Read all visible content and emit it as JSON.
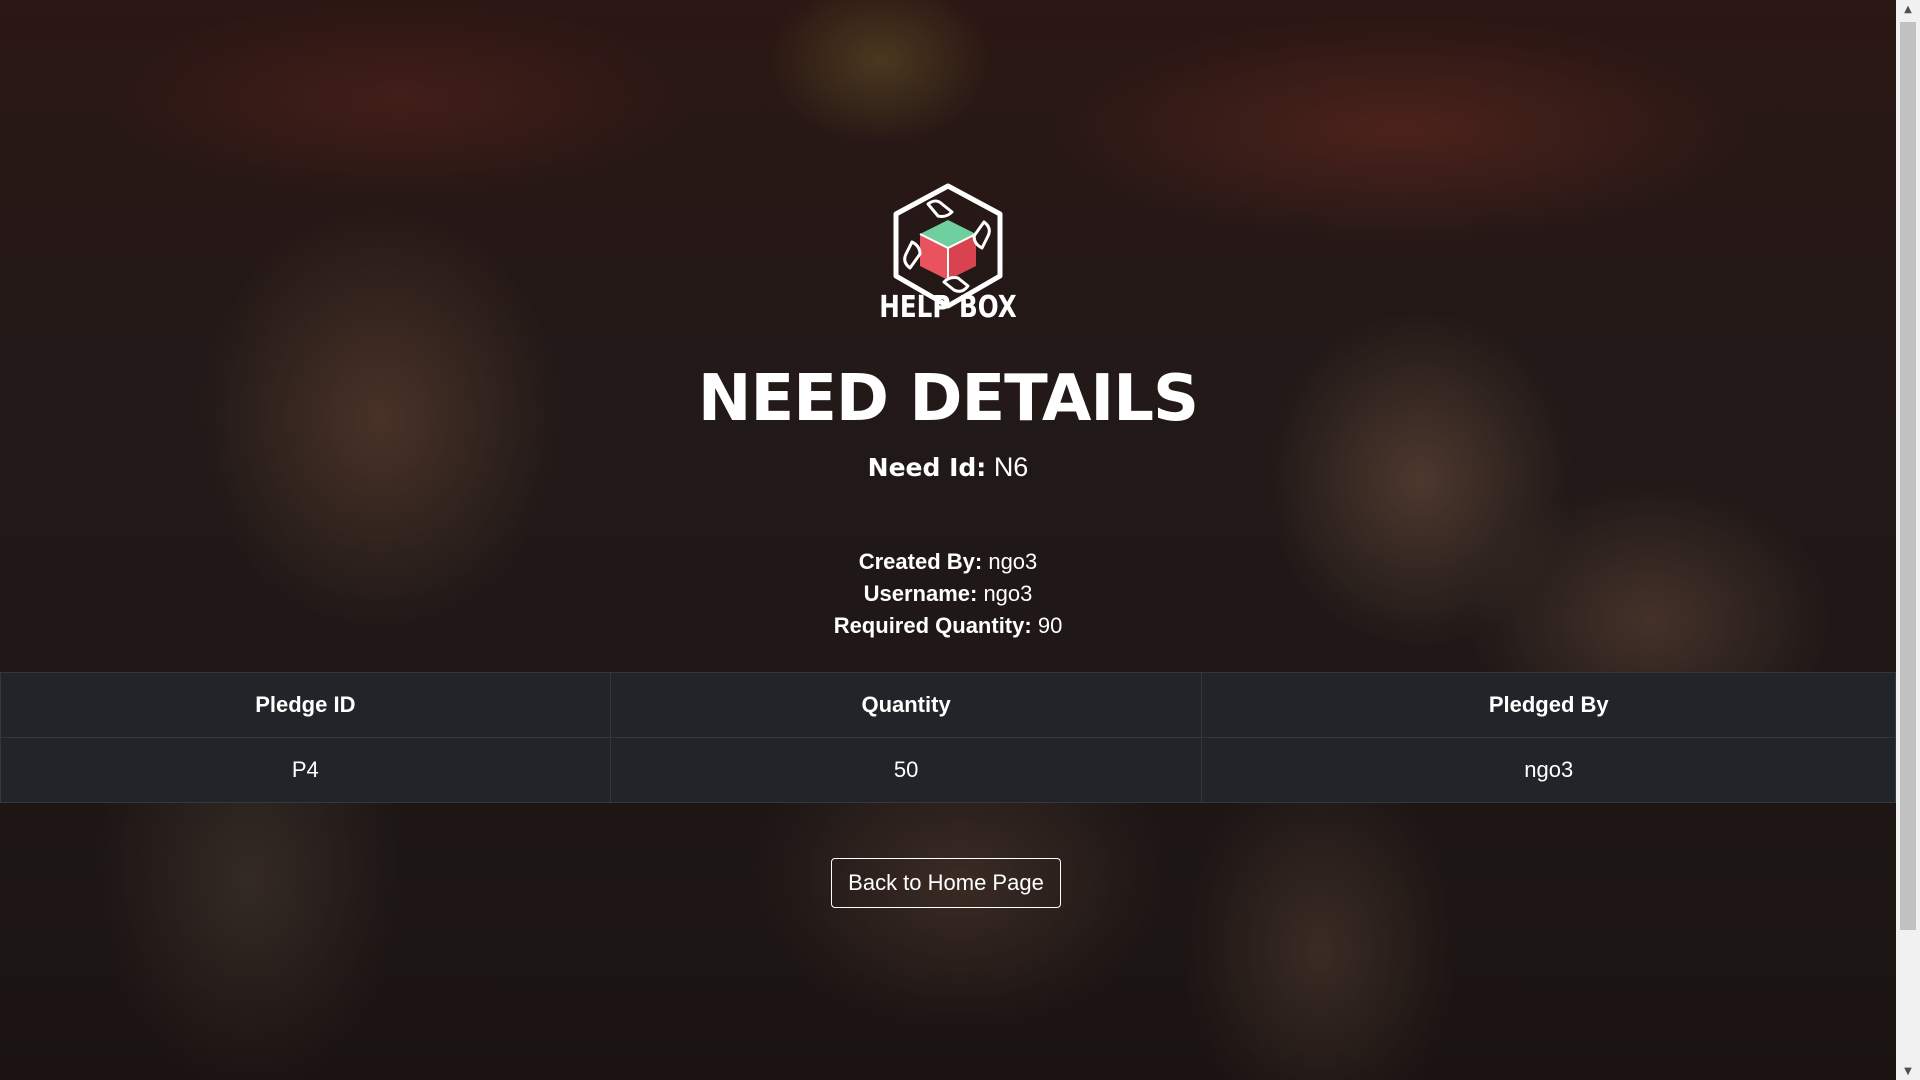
{
  "brand": {
    "name": "HELP BOX",
    "logo_icon": "helping-hands-box-icon",
    "colors": {
      "teal": "#6fcf9f",
      "red": "#e8535e",
      "white": "#ffffff"
    }
  },
  "page": {
    "title": "NEED DETAILS",
    "need_id_label": "Need Id:",
    "need_id_value": "N6"
  },
  "info": {
    "created_by_label": "Created By:",
    "created_by_value": "ngo3",
    "username_label": "Username:",
    "username_value": "ngo3",
    "required_quantity_label": "Required Quantity:",
    "required_quantity_value": "90"
  },
  "table": {
    "headers": [
      "Pledge ID",
      "Quantity",
      "Pledged By"
    ],
    "rows": [
      [
        "P4",
        "50",
        "ngo3"
      ]
    ]
  },
  "actions": {
    "back_label": "Back to Home Page"
  },
  "scrollbar": {
    "up_icon": "scroll-up-arrow-icon",
    "down_icon": "scroll-down-arrow-icon"
  }
}
